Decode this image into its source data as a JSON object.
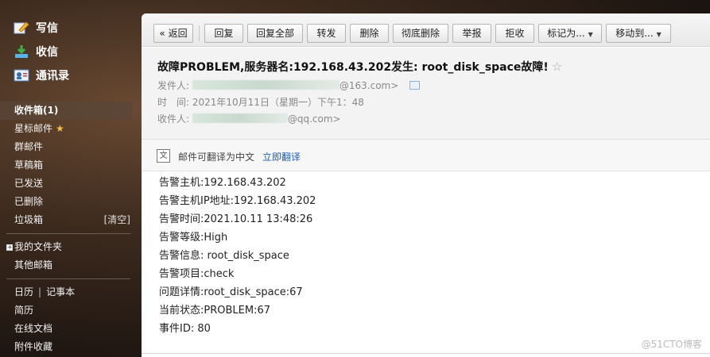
{
  "sidebar": {
    "main": [
      {
        "label": "写信",
        "icon": "pen-icon"
      },
      {
        "label": "收信",
        "icon": "download-icon"
      },
      {
        "label": "通讯录",
        "icon": "contacts-icon"
      }
    ],
    "folders": [
      {
        "label": "收件箱(1)",
        "active": true
      },
      {
        "label": "星标邮件"
      },
      {
        "label": "群邮件"
      },
      {
        "label": "草稿箱"
      },
      {
        "label": "已发送"
      },
      {
        "label": "已删除"
      },
      {
        "label": "垃圾箱",
        "extra": "[清空]"
      }
    ],
    "my_folders": "我的文件夹",
    "other_mailbox": "其他邮箱",
    "tools": {
      "calendar": "日历",
      "notes": "记事本",
      "resume": "简历",
      "online_docs": "在线文档",
      "attachments": "附件收藏"
    }
  },
  "toolbar": {
    "back": "« 返回",
    "reply": "回复",
    "reply_all": "回复全部",
    "forward": "转发",
    "delete": "删除",
    "delete_forever": "彻底删除",
    "report": "举报",
    "reject": "拒收",
    "mark_as": "标记为...",
    "move_to": "移动到..."
  },
  "email": {
    "subject": "故障PROBLEM,服务器名:192.168.43.202发生: root_disk_space故障!",
    "from_label": "发件人:",
    "from_suffix": "@163.com>",
    "time_label": "时　间:",
    "time_value": "2021年10月11日（星期一）下午1：48",
    "to_label": "收件人:",
    "to_suffix": "@qq.com>",
    "translate_text": "邮件可翻译为中文",
    "translate_link": "立即翻译",
    "body": [
      "告警主机:192.168.43.202",
      "告警主机IP地址:192.168.43.202",
      "告警时间:2021.10.11 13:48:26",
      "告警等级:High",
      "告警信息: root_disk_space",
      "告警项目:check",
      "问题详情:root_disk_space:67",
      "当前状态:PROBLEM:67",
      "事件ID: 80"
    ]
  },
  "watermark": "@51CTO博客"
}
